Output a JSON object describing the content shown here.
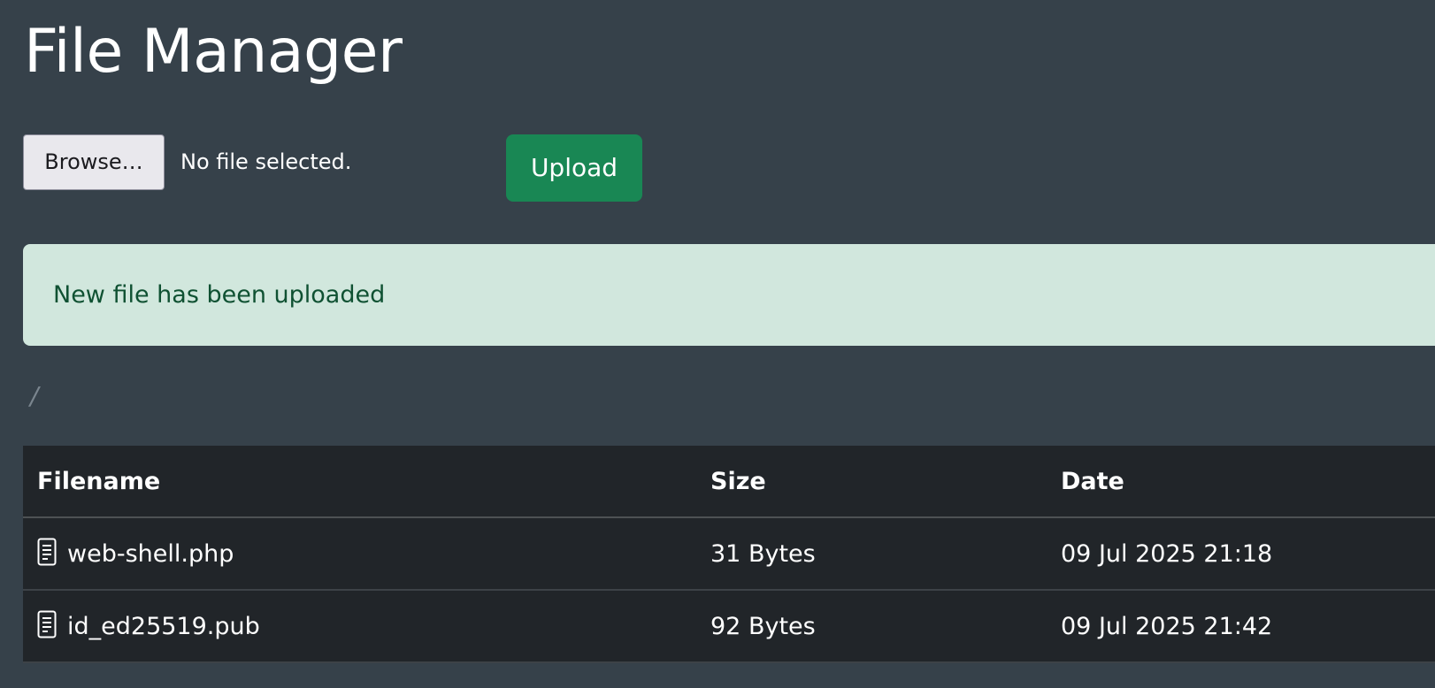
{
  "header": {
    "title": "File Manager"
  },
  "upload_form": {
    "browse_label": "Browse…",
    "file_status": "No file selected.",
    "upload_label": "Upload"
  },
  "alert": {
    "message": "New file has been uploaded"
  },
  "breadcrumb": {
    "path": "/"
  },
  "table": {
    "headers": {
      "filename": "Filename",
      "size": "Size",
      "date": "Date"
    },
    "rows": [
      {
        "icon": "file-text-icon",
        "filename": "web-shell.php",
        "size": "31 Bytes",
        "date": "09 Jul 2025 21:18"
      },
      {
        "icon": "file-text-icon",
        "filename": "id_ed25519.pub",
        "size": "92 Bytes",
        "date": "09 Jul 2025 21:42"
      }
    ]
  },
  "colors": {
    "background": "#36414a",
    "upload_button": "#198754",
    "alert_background": "#d1e7dd",
    "alert_text": "#0f5132",
    "table_background": "#212529"
  }
}
